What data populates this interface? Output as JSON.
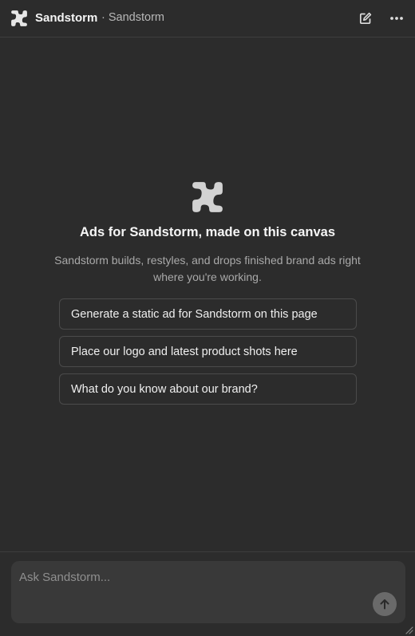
{
  "header": {
    "title": "Sandstorm",
    "subtitle": "· Sandstorm",
    "logo_icon": "sandstorm-logo-icon",
    "actions": [
      {
        "name": "new-chat",
        "icon": "edit-square-icon"
      },
      {
        "name": "more",
        "icon": "more-horizontal-icon"
      }
    ]
  },
  "hero": {
    "logo_icon": "sandstorm-logo-icon",
    "title": "Ads for Sandstorm, made on this canvas",
    "description": "Sandstorm builds, restyles, and drops finished brand ads right where you're working."
  },
  "suggestions": [
    {
      "label": "Generate a static ad for Sandstorm on this page"
    },
    {
      "label": "Place our logo and latest product shots here"
    },
    {
      "label": "What do you know about our brand?"
    }
  ],
  "composer": {
    "placeholder": "Ask Sandstorm...",
    "value": "",
    "send_icon": "arrow-up-icon"
  },
  "colors": {
    "background": "#2c2c2c",
    "composer": "#393939",
    "border": "#4b4b4b",
    "send_button": "#6a6a6a",
    "logo": "#d8d8d8"
  }
}
